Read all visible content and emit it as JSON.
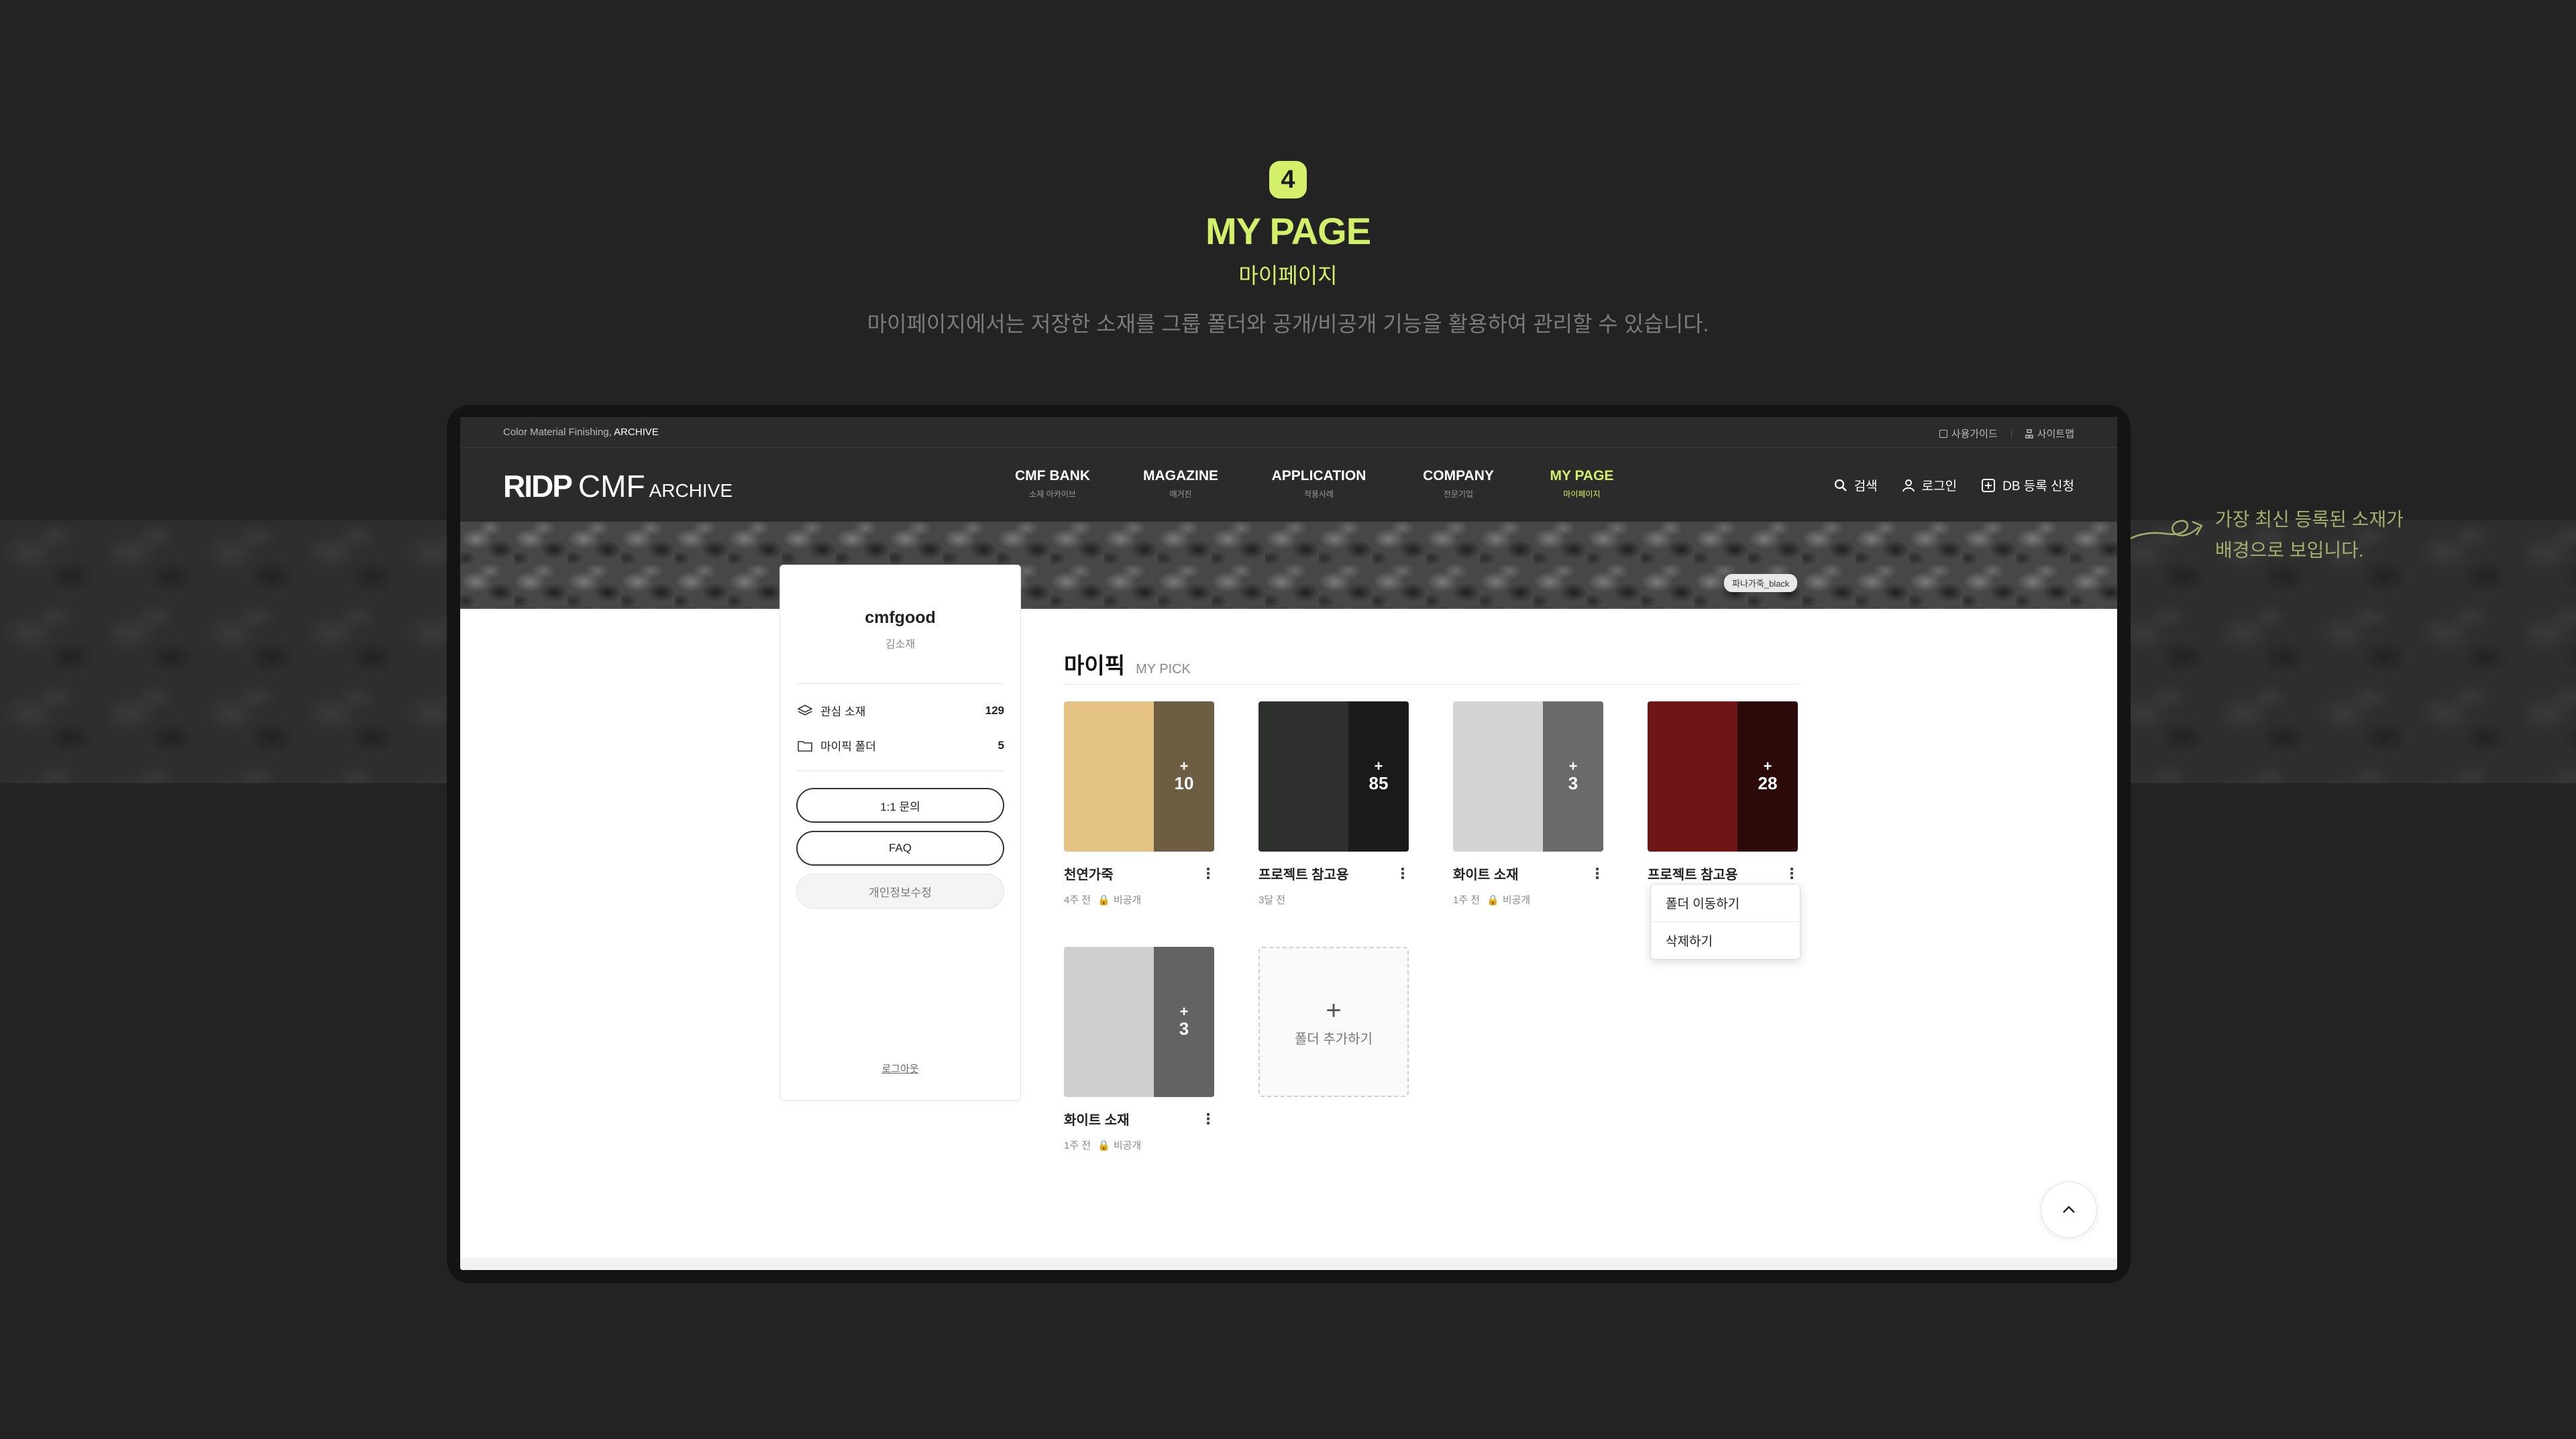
{
  "heading": {
    "badge": "4",
    "title": "MY PAGE",
    "subtitle": "마이페이지",
    "description": "마이페이지에서는 저장한 소재를 그룹 폴더와 공개/비공개 기능을 활용하여 관리할 수 있습니다."
  },
  "annotation": {
    "line1": "가장 최신 등록된 소재가",
    "line2": "배경으로 보입니다."
  },
  "util_bar": {
    "left_prefix": "Color Material Finishing,",
    "left_bold": "ARCHIVE",
    "links": [
      "사용가이드",
      "사이트맵"
    ]
  },
  "logo": {
    "ridp": "RIDP",
    "cmf": "CMF",
    "archive": "ARCHIVE"
  },
  "nav": {
    "items": [
      {
        "en": "CMF BANK",
        "ko": "소재 아카이브"
      },
      {
        "en": "MAGAZINE",
        "ko": "매거진"
      },
      {
        "en": "APPLICATION",
        "ko": "적용사례"
      },
      {
        "en": "COMPANY",
        "ko": "전문기업"
      },
      {
        "en": "MY PAGE",
        "ko": "마이페이지"
      }
    ],
    "active_index": 4,
    "actions": [
      "검색",
      "로그인",
      "DB 등록 신청"
    ]
  },
  "hero": {
    "tag": "파나가죽_black"
  },
  "profile": {
    "username": "cmfgood",
    "name": "김소재",
    "stats": [
      {
        "label": "관심 소재",
        "value": "129",
        "icon": "layers-icon"
      },
      {
        "label": "마이픽 폴더",
        "value": "5",
        "icon": "folder-icon"
      }
    ],
    "buttons": [
      "1:1 문의",
      "FAQ",
      "개인정보수정"
    ],
    "logout": "로그아웃"
  },
  "pick": {
    "title": "마이픽",
    "subtitle": "MY PICK",
    "folders": [
      {
        "name": "천연가죽",
        "count": "10",
        "time": "4주 전",
        "privacy": "비공개",
        "swatch": "#e3c284",
        "shade": "#6d5d43"
      },
      {
        "name": "프로젝트 참고용",
        "count": "85",
        "time": "3달 전",
        "privacy": "",
        "swatch": "#2e302e",
        "shade": "#1a1a1a"
      },
      {
        "name": "화이트 소재",
        "count": "3",
        "time": "1주 전",
        "privacy": "비공개",
        "swatch": "#d4d4d4",
        "shade": "#6a6a6a"
      },
      {
        "name": "프로젝트 참고용",
        "count": "28",
        "time": "",
        "privacy": "",
        "swatch": "#6e1616",
        "shade": "#2c0a0a"
      },
      {
        "name": "화이트 소재",
        "count": "3",
        "time": "1주 전",
        "privacy": "비공개",
        "swatch": "#cfcfcf",
        "shade": "#636363"
      }
    ],
    "add_label": "폴더 추가하기",
    "dropdown": [
      "폴더 이동하기",
      "삭제하기"
    ]
  },
  "colors": {
    "accent": "#d4f06a",
    "dark_bg": "#232323",
    "nav_bg": "#2b2b2b"
  }
}
